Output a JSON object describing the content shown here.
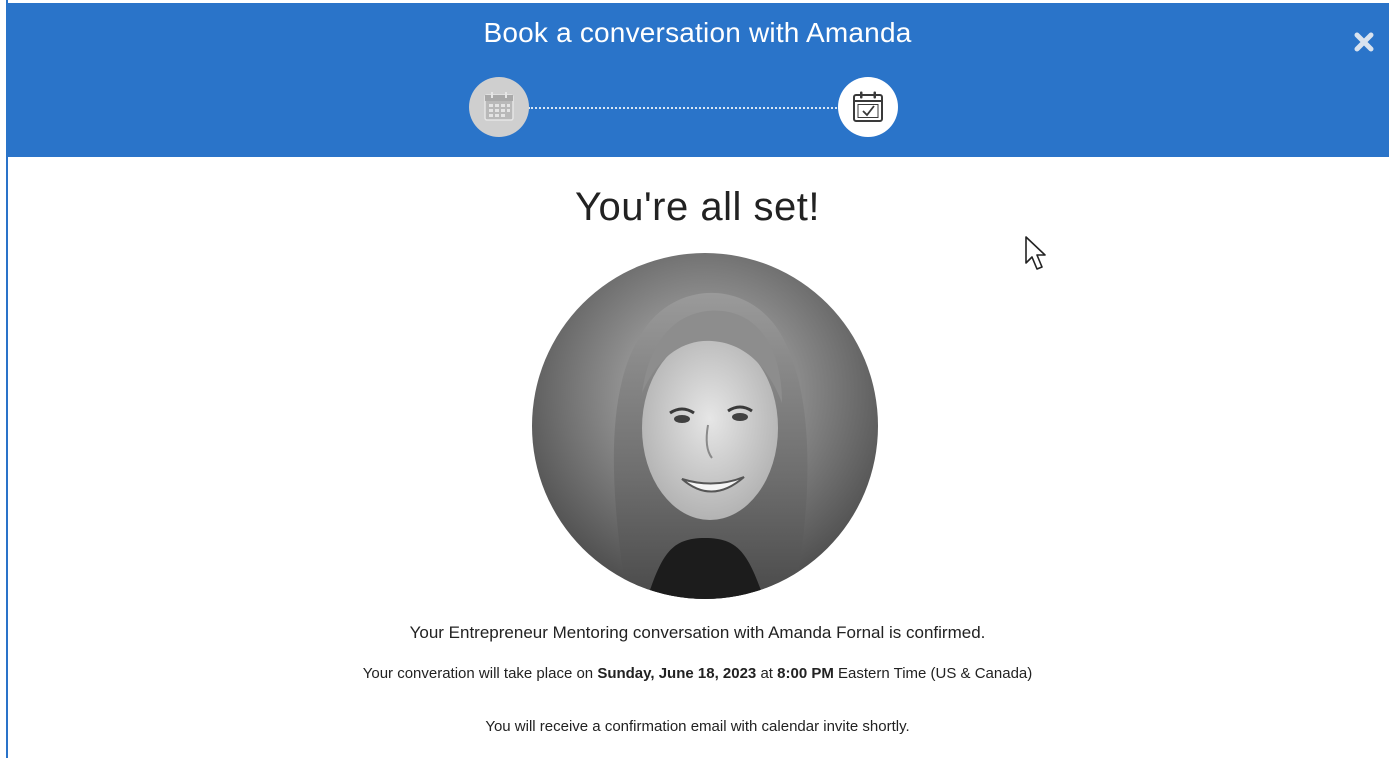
{
  "header": {
    "title": "Book a conversation with Amanda",
    "close_icon": "close-icon",
    "background": "#2a74c9"
  },
  "stepper": {
    "steps": [
      {
        "icon": "calendar-icon",
        "state": "completed"
      },
      {
        "icon": "calendar-check-icon",
        "state": "current"
      }
    ]
  },
  "content": {
    "headline": "You're all set!",
    "avatar_icon": "mentor-photo",
    "confirm_text": "Your Entrepreneur Mentoring conversation with Amanda Fornal is confirmed.",
    "when": {
      "prefix": "Your converation will take place on ",
      "date": "Sunday, June 18, 2023",
      "at": " at ",
      "time": "8:00 PM",
      "suffix": " Eastern Time (US & Canada)"
    },
    "email_text": "You will receive a confirmation email with calendar invite shortly."
  }
}
